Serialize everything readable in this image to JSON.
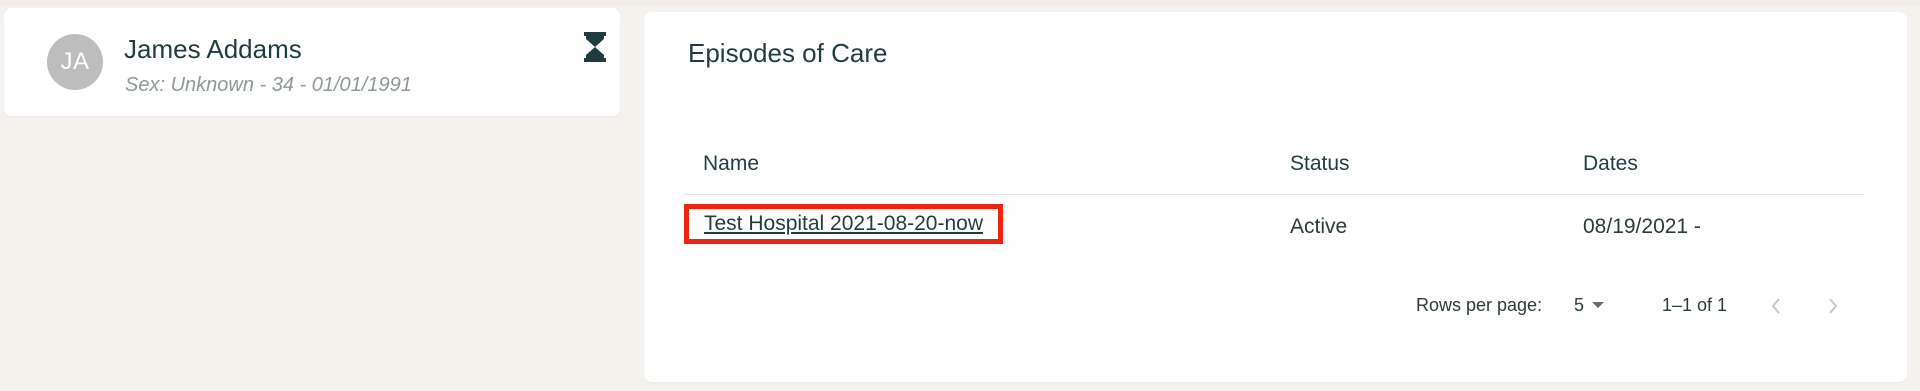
{
  "patient": {
    "initials": "JA",
    "name": "James Addams",
    "meta": "Sex: Unknown - 34 - 01/01/1991"
  },
  "episodes": {
    "title": "Episodes of Care",
    "columns": {
      "name": "Name",
      "status": "Status",
      "dates": "Dates"
    },
    "rows": [
      {
        "name": "Test Hospital 2021-08-20-now",
        "status": "Active",
        "dates": "08/19/2021 -"
      }
    ],
    "pagination": {
      "rows_per_page_label": "Rows per page:",
      "rows_per_page_value": "5",
      "range": "1–1 of 1"
    }
  },
  "colors": {
    "text_primary": "#1f3d3f",
    "highlight_border": "#ec2410",
    "avatar_bg": "#bdbdbd",
    "page_bg": "#f5f2ee"
  },
  "icons": {
    "status_icon": "hourglass-icon",
    "rows_dropdown": "caret-down-icon",
    "prev_page": "chevron-left-icon",
    "next_page": "chevron-right-icon"
  }
}
